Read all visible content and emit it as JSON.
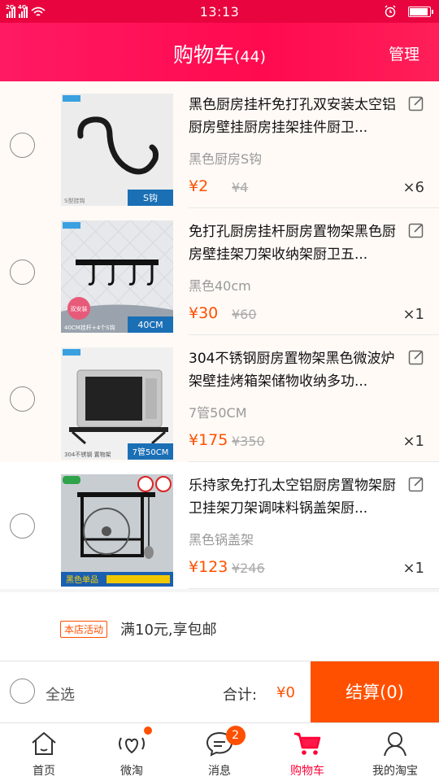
{
  "status_bar": {
    "time": "13:13",
    "signal1": "2G",
    "signal2": "4G"
  },
  "header": {
    "title": "购物车",
    "count": "(44)",
    "manage": "管理"
  },
  "items": [
    {
      "name": "黑色厨房挂杆免打孔双安装太空铝厨房壁挂厨房挂架挂件厨卫...",
      "sku": "黑色厨房S钩",
      "price": "¥2",
      "orig": "¥4",
      "qty": "×6",
      "img_caption": "S钩",
      "img_small": "S型挂钩"
    },
    {
      "name": "免打孔厨房挂杆厨房置物架黑色厨房壁挂架刀架收纳架厨卫五...",
      "sku": "黑色40cm",
      "price": "¥30",
      "orig": "¥60",
      "qty": "×1",
      "img_caption": "40CM",
      "img_small": "40CM挂杆+4个S钩",
      "img_badge": "双安装"
    },
    {
      "name": "304不锈钢厨房置物架黑色微波炉架壁挂烤箱架储物收纳多功...",
      "sku": "7管50CM",
      "price": "¥175",
      "orig": "¥350",
      "qty": "×1",
      "img_caption": "7管50CM",
      "img_small": "304不锈钢 置物架"
    },
    {
      "name": "乐持家免打孔太空铝厨房置物架厨卫挂架刀架调味料锅盖架厨...",
      "sku": "黑色锅盖架",
      "price": "¥123",
      "orig": "¥246",
      "qty": "×1",
      "img_caption": "黑色单品"
    }
  ],
  "promo": {
    "tag": "本店活动",
    "text": "满10元,享包邮"
  },
  "checkout": {
    "select_all": "全选",
    "total_label": "合计:",
    "total": "¥0",
    "pay": "结算(0)"
  },
  "tabs": [
    {
      "label": "首页",
      "icon": "home-icon"
    },
    {
      "label": "微淘",
      "icon": "heart-wave-icon"
    },
    {
      "label": "消息",
      "icon": "chat-icon",
      "badge": "2"
    },
    {
      "label": "购物车",
      "icon": "cart-icon"
    },
    {
      "label": "我的淘宝",
      "icon": "profile-icon"
    }
  ],
  "colors": {
    "accent": "#ff0a4f",
    "price": "#ff5000"
  }
}
